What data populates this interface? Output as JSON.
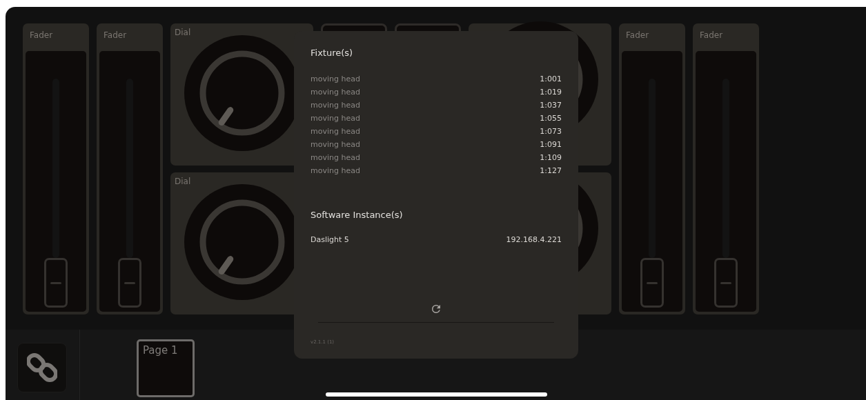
{
  "columns": [
    {
      "widgets": [
        {
          "kind": "fader",
          "label": "Fader"
        }
      ]
    },
    {
      "widgets": [
        {
          "kind": "fader",
          "label": "Fader"
        }
      ]
    },
    {
      "widgets": [
        {
          "kind": "dial",
          "label": "Dial"
        },
        {
          "kind": "dial",
          "label": "Dial"
        }
      ]
    },
    {
      "widgets": [
        {
          "kind": "pad"
        }
      ]
    },
    {
      "widgets": [
        {
          "kind": "pad"
        }
      ]
    },
    {
      "widgets": [
        {
          "kind": "dial"
        },
        {
          "kind": "dial"
        }
      ]
    },
    {
      "widgets": [
        {
          "kind": "fader",
          "label": "Fader"
        }
      ]
    },
    {
      "widgets": [
        {
          "kind": "fader",
          "label": "Fader"
        }
      ]
    }
  ],
  "popup": {
    "fixtures_title": "Fixture(s)",
    "fixtures": [
      {
        "name": "moving head",
        "address": "1:001"
      },
      {
        "name": "moving head",
        "address": "1:019"
      },
      {
        "name": "moving head",
        "address": "1:037"
      },
      {
        "name": "moving head",
        "address": "1:055"
      },
      {
        "name": "moving head",
        "address": "1:073"
      },
      {
        "name": "moving head",
        "address": "1:091"
      },
      {
        "name": "moving head",
        "address": "1:109"
      },
      {
        "name": "moving head",
        "address": "1:127"
      }
    ],
    "instances_title": "Software Instance(s)",
    "instances": [
      {
        "name": "Daslight 5",
        "ip": "192.168.4.221"
      }
    ],
    "version": "v2.1.1 (1)"
  },
  "pages": [
    {
      "label": "Page 1",
      "selected": true
    }
  ]
}
